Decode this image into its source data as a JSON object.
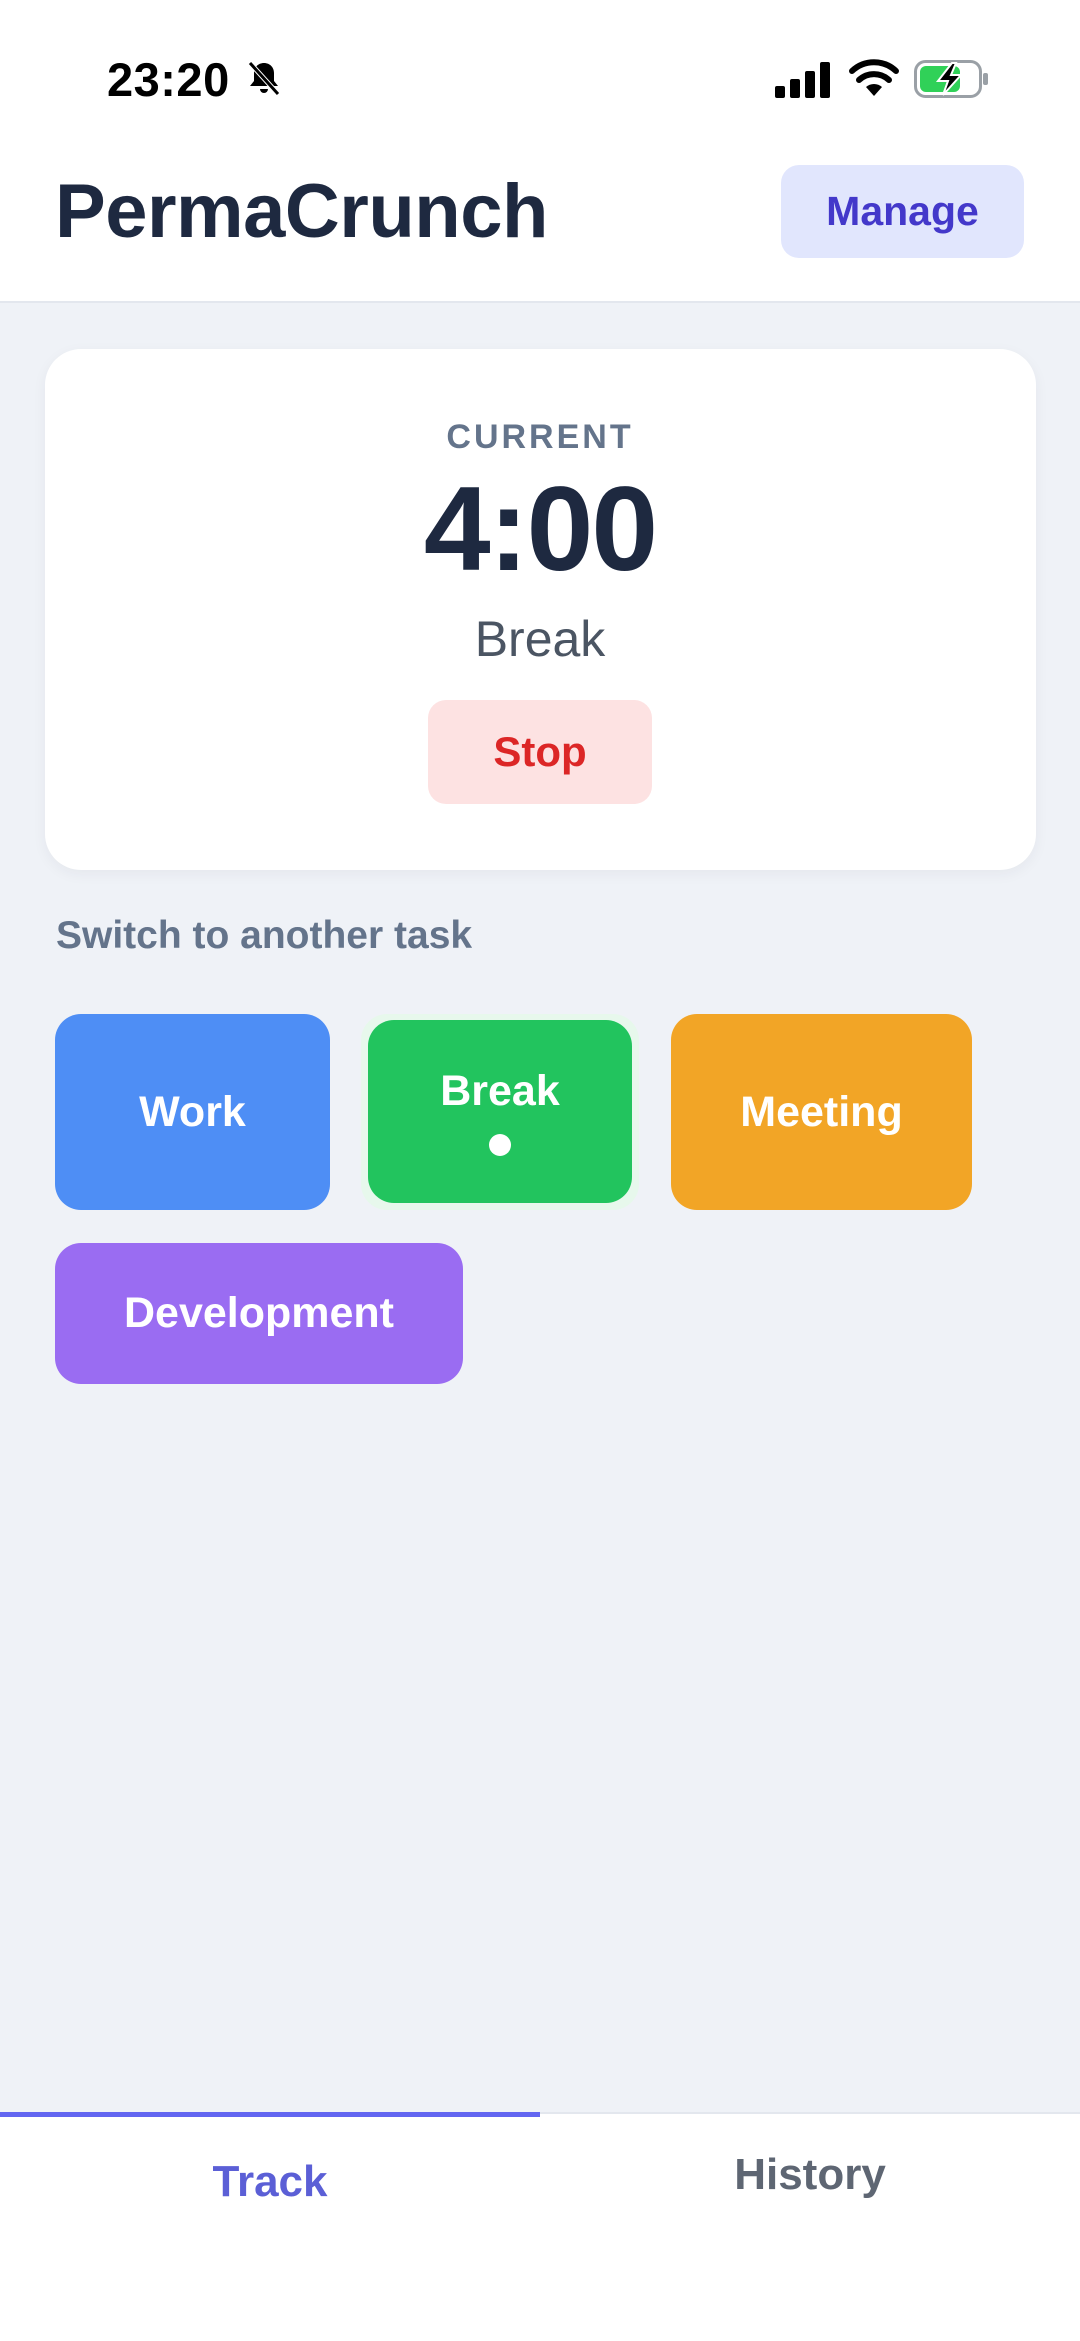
{
  "status_bar": {
    "time": "23:20",
    "icons": [
      "bell-slash-icon",
      "signal-icon",
      "wifi-icon",
      "battery-charging-icon"
    ],
    "battery_color": "#30d158"
  },
  "header": {
    "title": "PermaCrunch",
    "manage_label": "Manage"
  },
  "current": {
    "label": "CURRENT",
    "timer": "4:00",
    "task": "Break",
    "stop_label": "Stop"
  },
  "switch_section": {
    "label": "Switch to another task",
    "tasks": [
      {
        "name": "Work",
        "color": "#4e8ef5",
        "active": false
      },
      {
        "name": "Break",
        "color": "#22c45e",
        "active": true
      },
      {
        "name": "Meeting",
        "color": "#f2a526",
        "active": false
      },
      {
        "name": "Development",
        "color": "#9a6cf2",
        "active": false
      }
    ]
  },
  "tabs": [
    {
      "label": "Track",
      "active": true
    },
    {
      "label": "History",
      "active": false
    }
  ],
  "colors": {
    "accent": "#6366f1",
    "stop_red": "#dc2626"
  }
}
